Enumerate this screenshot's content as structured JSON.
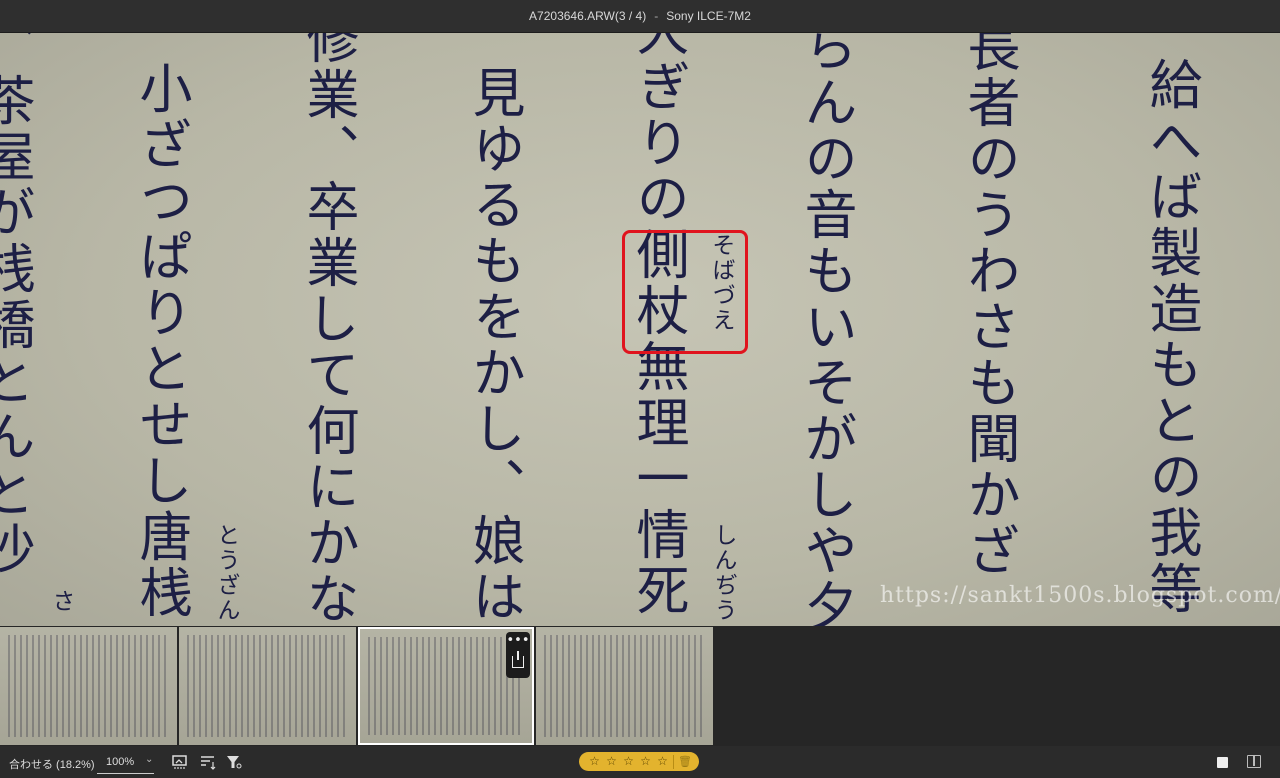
{
  "window": {
    "filename": "A7203646.ARW(3 / 4)",
    "separator": "-",
    "camera": "Sony ILCE-7M2"
  },
  "image": {
    "columns": [
      {
        "text": "給へば製造もとの我等"
      },
      {
        "text": "長者のうわさも聞かざ"
      },
      {
        "text": "らんの音もいそがしや夕"
      },
      {
        "text": "大ぎりの側杖無理一情死"
      },
      {
        "text": "、見ゆるもをかし、娘は"
      },
      {
        "text": "修業、卒業して何にかな"
      },
      {
        "text": "小ざつぱりとせし唐桟"
      },
      {
        "text": "、茶屋が桟橋とんと沙"
      }
    ],
    "ruby": [
      {
        "text": "そばづえ"
      },
      {
        "text": "しんぢう"
      },
      {
        "text": "とうざん"
      },
      {
        "text": "さ"
      }
    ],
    "highlight_word": "側杖",
    "watermark": "https://sankt1500s.blogspot.com/"
  },
  "filmstrip": {
    "count": 4,
    "selected_index": 2,
    "more_icon": "more-horizontal-icon",
    "export_icon": "export-icon"
  },
  "statusbar": {
    "fit_label": "合わせる (18.2%)",
    "zoom_value": "100%",
    "rating_stars": 0,
    "star_glyph": "☆",
    "trash_glyph": "🗑",
    "rating_color": "#e3b32e"
  }
}
